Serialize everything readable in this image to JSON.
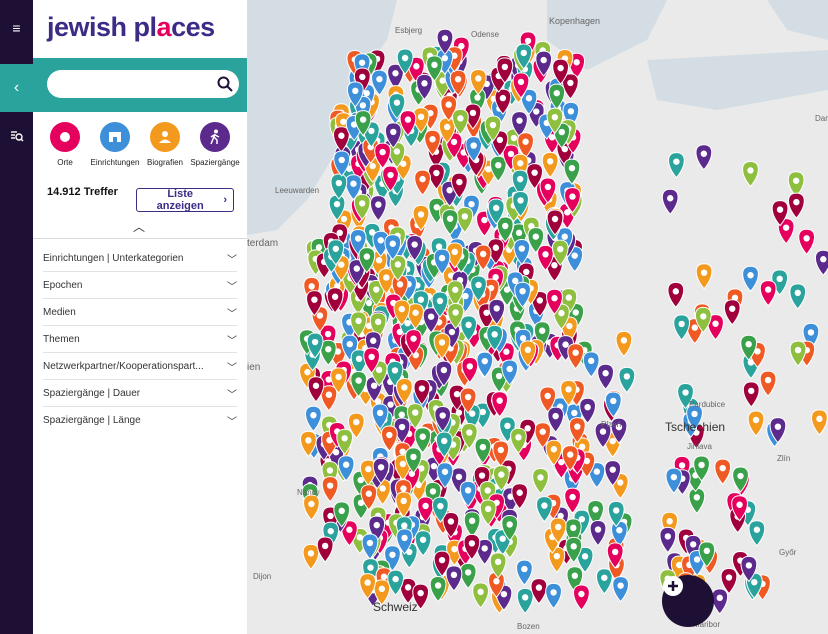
{
  "app": {
    "logo_main": "jewish pl",
    "logo_accent": "a",
    "logo_tail": "ces"
  },
  "search": {
    "placeholder": "",
    "value": ""
  },
  "categories": [
    {
      "label": "Orte",
      "color": "#e4005c",
      "icon": "pin-icon"
    },
    {
      "label": "Einrichtungen",
      "color": "#3d8fd9",
      "icon": "building-icon"
    },
    {
      "label": "Biografien",
      "color": "#f39a1e",
      "icon": "person-icon"
    },
    {
      "label": "Spaziergänge",
      "color": "#5b2a8c",
      "icon": "walker-icon"
    }
  ],
  "results": {
    "count": "14.912 Treffer",
    "list_button": "Liste anzeigen"
  },
  "filters": [
    "Einrichtungen | Unterkategorien",
    "Epochen",
    "Medien",
    "Themen",
    "Netzwerkpartner/Kooperationspart...",
    "Spaziergänge | Dauer",
    "Spaziergänge | Länge"
  ],
  "map_labels": {
    "kopenhagen": "Kopenhagen",
    "esbjerg": "Esbjerg",
    "odense": "Odense",
    "leeuwarden": "Leeuwarden",
    "amsterdam": "terdam",
    "bruessel": "ien",
    "nancy": "Nancy",
    "dijon": "Dijon",
    "schweiz": "Schweiz",
    "tschechien": "Tschechien",
    "pardubice": "Pardubice",
    "plzen": "Plzeň",
    "jihlava": "Jihlava",
    "zlin": "Zlín",
    "gyor": "Győr",
    "bozen": "Bozen",
    "maribor": "Maribor",
    "danzig": "Dan"
  },
  "colors": {
    "brand_dark": "#1e1035",
    "brand_purple": "#3d2b86",
    "teal": "#2aa39d",
    "marker_colors": [
      "#e4005c",
      "#3d8fd9",
      "#f39a1e",
      "#5b2a8c",
      "#2aa39d",
      "#ef5a24",
      "#3aa14a",
      "#a0003c",
      "#8fbf3f"
    ]
  }
}
